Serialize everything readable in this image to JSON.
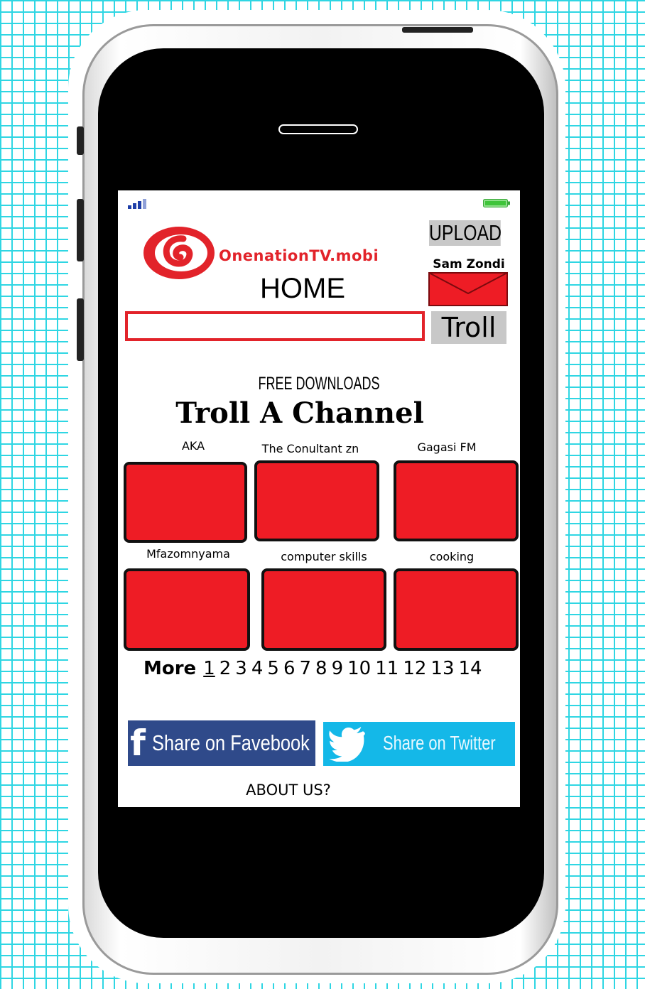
{
  "app": {
    "logo_text": "OnenationTV.mobi",
    "page_title": "HOME"
  },
  "header": {
    "upload_label": "UPLOAD",
    "user_name": "Sam Zondi"
  },
  "search": {
    "value": "",
    "placeholder": "",
    "button_label": "Troll"
  },
  "main": {
    "subheading": "FREE DOWNLOADS",
    "heading": "Troll A Channel",
    "channels": [
      {
        "name": "AKA"
      },
      {
        "name": "The Conultant zn"
      },
      {
        "name": "Gagasi FM"
      },
      {
        "name": "Mfazomnyama"
      },
      {
        "name": "computer skills"
      },
      {
        "name": "cooking"
      }
    ]
  },
  "pagination": {
    "more_label": "More",
    "pages": [
      "1",
      "2",
      "3",
      "4",
      "5",
      "6",
      "7",
      "8",
      "9",
      "10",
      "11",
      "12",
      "13",
      "14"
    ],
    "current": "1"
  },
  "share": {
    "facebook_label": "Share on Favebook",
    "twitter_label": "Share on Twitter"
  },
  "footer": {
    "about_label": "ABOUT US?"
  },
  "colors": {
    "brand_red": "#e2232a",
    "tile_red": "#ee1c25",
    "facebook_blue": "#2f4a8a",
    "twitter_blue": "#14b8e8",
    "grid_cyan": "#2fd6e3"
  },
  "icons": [
    "signal-icon",
    "battery-icon",
    "mail-icon",
    "facebook-icon",
    "twitter-bird-icon"
  ]
}
